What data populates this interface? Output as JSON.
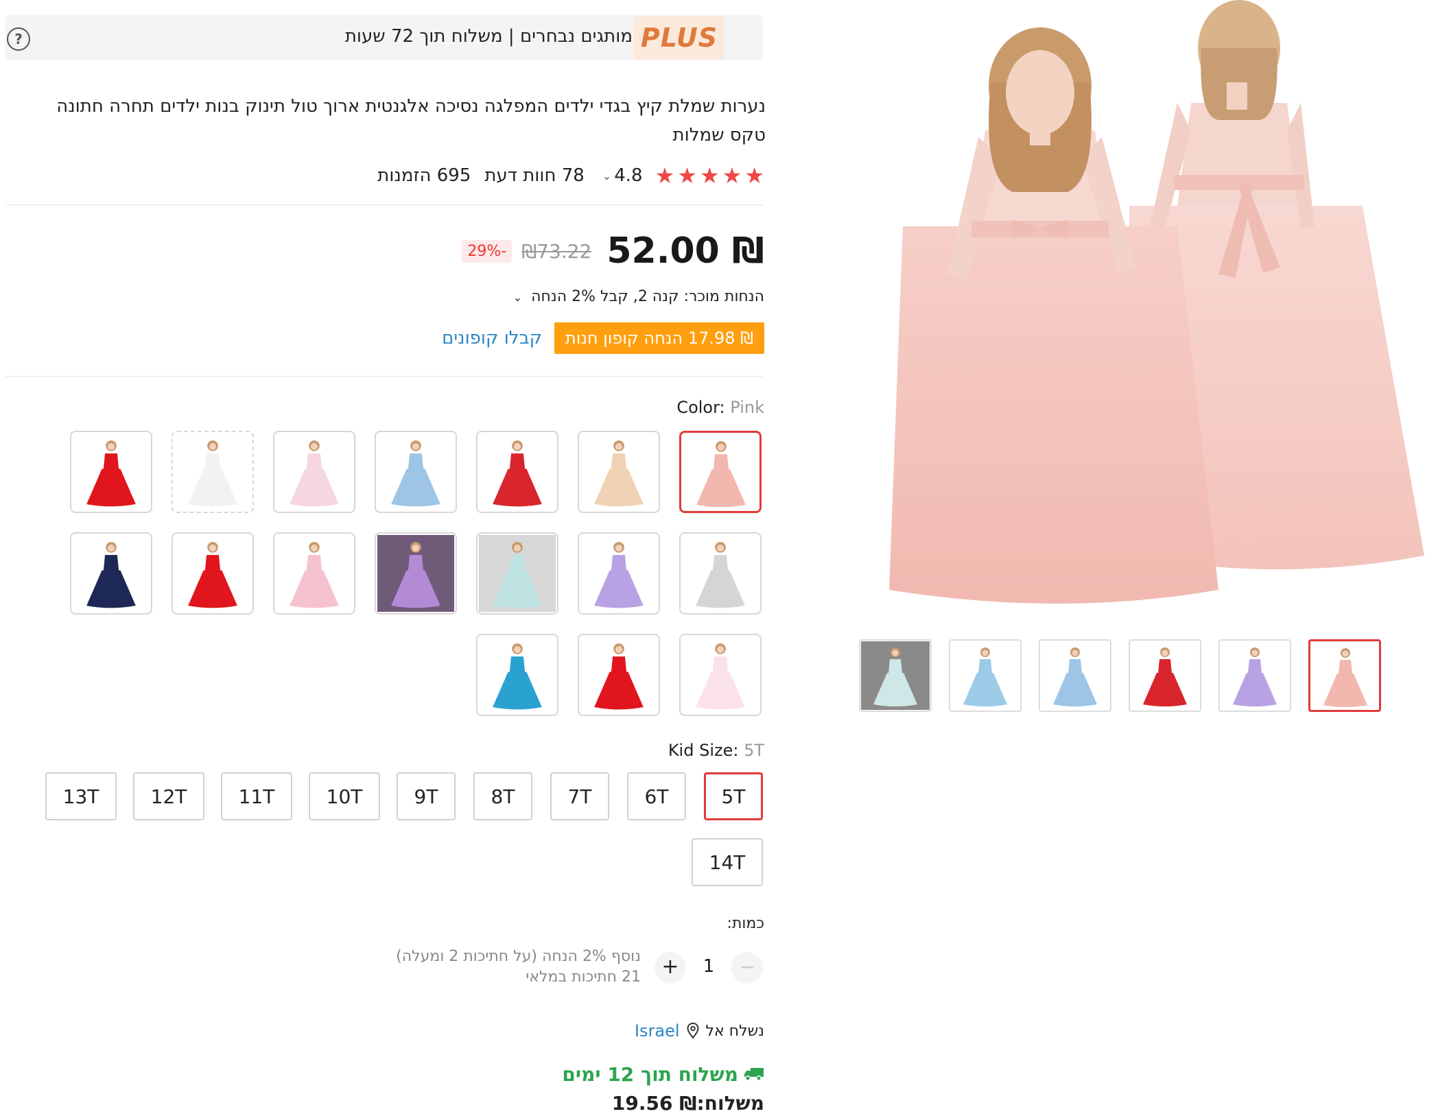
{
  "plus_banner": {
    "logo": "PLUS",
    "text": "מותגים נבחרים | משלוח תוך 72 שעות",
    "help": "?"
  },
  "product": {
    "title": "נערות שמלת קיץ בגדי ילדים המפלגה נסיכה אלגנטית ארוך טול תינוק בנות ילדים תחרה חתונה טקס שמלות",
    "rating": "4.8",
    "reviews": "78 חוות דעת",
    "orders": "695 הזמנות",
    "stars": 5
  },
  "price": {
    "current": "₪ 52.00",
    "original": "₪73.22",
    "discount": "-29%"
  },
  "promotions": {
    "seller_discount": "הנחות מוכר: קנה 2, קבל 2% הנחה",
    "coupon": "₪ 17.98 הנחה קופון חנות",
    "coupon_link": "קבלו קופונים"
  },
  "color": {
    "label": "Color: ",
    "selected": "Pink",
    "options": [
      {
        "name": "pink",
        "fill": "#f2b8b0",
        "bg": "#fff"
      },
      {
        "name": "champagne",
        "fill": "#f0d3b4",
        "bg": "#fff"
      },
      {
        "name": "red-long-sleeve",
        "fill": "#d9252c",
        "bg": "#fff"
      },
      {
        "name": "sky-blue",
        "fill": "#9ec5e6",
        "bg": "#fff"
      },
      {
        "name": "light-pink",
        "fill": "#f7d7df",
        "bg": "#fff"
      },
      {
        "name": "white",
        "fill": "#f2f2f2",
        "bg": "#fff"
      },
      {
        "name": "red",
        "fill": "#e1151d",
        "bg": "#fff"
      },
      {
        "name": "grey",
        "fill": "#d5d5d5",
        "bg": "#fff"
      },
      {
        "name": "purple",
        "fill": "#b9a2e3",
        "bg": "#fff"
      },
      {
        "name": "mint",
        "fill": "#bfe3e3",
        "bg": "#d7d7d7"
      },
      {
        "name": "lavender-photo",
        "fill": "#b28ad6",
        "bg": "#6f5a78"
      },
      {
        "name": "baby-pink",
        "fill": "#f7c2cf",
        "bg": "#fff"
      },
      {
        "name": "red-sleeveless",
        "fill": "#e1151d",
        "bg": "#fff"
      },
      {
        "name": "navy",
        "fill": "#1e2856",
        "bg": "#fff"
      },
      {
        "name": "white-pink",
        "fill": "#fbe2e8",
        "bg": "#fff"
      },
      {
        "name": "red-v",
        "fill": "#e1151d",
        "bg": "#fff"
      },
      {
        "name": "turquoise",
        "fill": "#2aa2d0",
        "bg": "#fff"
      }
    ]
  },
  "size": {
    "label": "Kid Size: ",
    "selected": "5T",
    "options": [
      "5T",
      "6T",
      "7T",
      "8T",
      "9T",
      "10T",
      "11T",
      "12T",
      "13T",
      "14T"
    ]
  },
  "quantity": {
    "label": "כמות:",
    "value": "1",
    "minus": "−",
    "plus": "+",
    "note_line1": "נוסף 2% הנחה (על חתיכות 2 ומעלה)",
    "note_line2": "21 חתיכות במלאי"
  },
  "shipping": {
    "ship_to_label": "נשלח אל",
    "country": "Israel",
    "delivery": "משלוח תוך 12 ימים",
    "cost": "משלוח:₪ 19.56"
  },
  "gallery": {
    "thumbs": [
      {
        "name": "mint-photo",
        "fill": "#cfe7e6",
        "bg": "#8a8a8a"
      },
      {
        "name": "three-girls",
        "fill": "#9ccbe8",
        "bg": "#fff"
      },
      {
        "name": "blue-dress",
        "fill": "#9ec5e6",
        "bg": "#fff"
      },
      {
        "name": "red-dress",
        "fill": "#d9252c",
        "bg": "#fff"
      },
      {
        "name": "purple-dress",
        "fill": "#b9a2e3",
        "bg": "#fff"
      },
      {
        "name": "pink-dress",
        "fill": "#f2b8b0",
        "bg": "#fff"
      }
    ]
  },
  "colors": {
    "accent_red": "#e13a3a",
    "coupon_orange": "#ff9f0f",
    "link_blue": "#2a86c4",
    "delivery_green": "#2ea44f"
  }
}
